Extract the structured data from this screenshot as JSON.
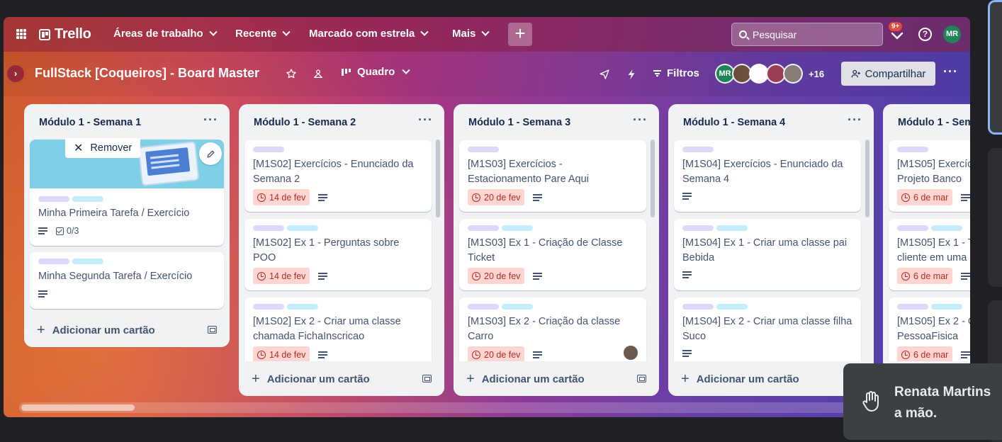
{
  "topnav": {
    "logo": "Trello",
    "menus": [
      {
        "label": "Áreas de trabalho"
      },
      {
        "label": "Recente"
      },
      {
        "label": "Marcado com estrela"
      },
      {
        "label": "Mais"
      }
    ],
    "create_label": "+",
    "search_placeholder": "Pesquisar",
    "notification_badge": "9+",
    "help_label": "?",
    "avatar_initials": "MR"
  },
  "board": {
    "title": "FullStack [Coqueiros] - Board Master",
    "view_label": "Quadro",
    "filters_label": "Filtros",
    "member_initials": "MR",
    "member_more": "+16",
    "share_label": "Compartilhar",
    "more_label": "···",
    "collapse_label": "›"
  },
  "lists": [
    {
      "title": "Módulo 1 - Semana 1",
      "remove_label": "Remover",
      "cards": [
        {
          "title": "Minha Primeira Tarefa / Exercício",
          "checklist": "0/3"
        },
        {
          "title": "Minha Segunda Tarefa / Exercício"
        }
      ],
      "add_label": "Adicionar um cartão"
    },
    {
      "title": "Módulo 1 - Semana 2",
      "cards": [
        {
          "title": "[M1S02] Exercícios - Enunciado da Semana 2",
          "due": "14 de fev"
        },
        {
          "title": "[M1S02] Ex 1 - Perguntas sobre POO",
          "due": "14 de fev"
        },
        {
          "title": "[M1S02] Ex 2 - Criar uma classe chamada FichaInscricao",
          "due": "14 de fev"
        }
      ],
      "add_label": "Adicionar um cartão"
    },
    {
      "title": "Módulo 1 - Semana 3",
      "cards": [
        {
          "title": "[M1S03] Exercícios - Estacionamento Pare Aqui",
          "due": "20 de fev"
        },
        {
          "title": "[M1S03] Ex 1 - Criação de Classe Ticket",
          "due": "20 de fev"
        },
        {
          "title": "[M1S03] Ex 2 - Criação da classe Carro",
          "due": "20 de fev"
        }
      ],
      "add_label": "Adicionar um cartão"
    },
    {
      "title": "Módulo 1 - Semana 4",
      "cards": [
        {
          "title": "[M1S04] Exercícios - Enunciado da Semana 4"
        },
        {
          "title": "[M1S04] Ex 1 - Criar uma classe pai Bebida"
        },
        {
          "title": "[M1S04] Ex 2 - Criar uma classe filha Suco"
        }
      ],
      "add_label": "Adicionar um cartão"
    },
    {
      "title": "Módulo 1 - Sem",
      "cards": [
        {
          "title": "[M1S05] Exercíc\nProjeto Banco",
          "due": "6 de mar"
        },
        {
          "title": "[M1S05] Ex 1 - T\ncliente em uma",
          "due": "6 de mar"
        },
        {
          "title": "[M1S05] Ex 2 - C\nPessoaFisica",
          "due": "6 de mar"
        }
      ]
    }
  ],
  "toast": {
    "line1": "Renata Martins",
    "line2": "a mão."
  },
  "colors": {
    "label_purple": "#dfd8fd",
    "label_cyan": "#c6edfb",
    "due_bg": "#ffd5d2",
    "due_fg": "#ae2e24",
    "share_bg": "#dfe1e6"
  }
}
